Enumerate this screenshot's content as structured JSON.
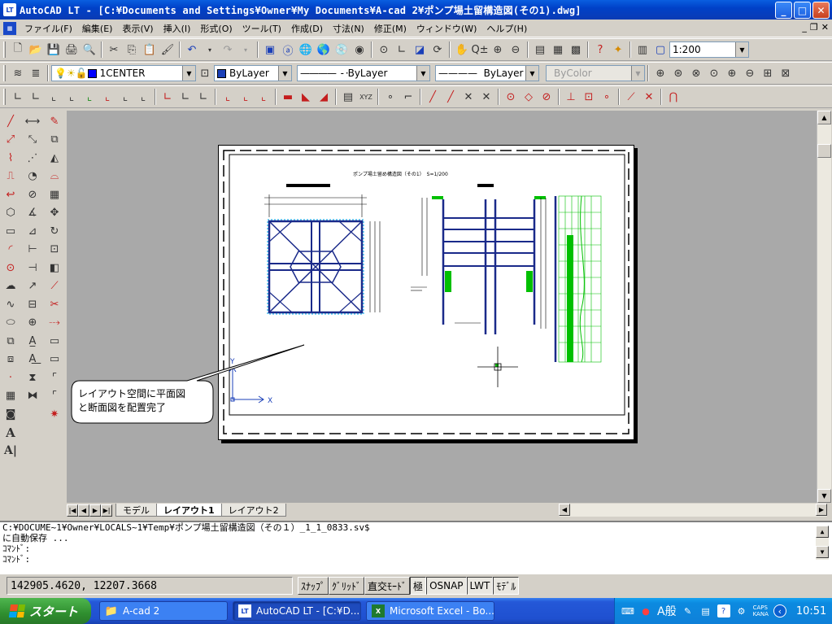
{
  "window": {
    "app_icon": "LT",
    "title": "AutoCAD LT - [C:¥Documents and Settings¥Owner¥My Documents¥A-cad 2¥ポンプ場土留構造図(その1).dwg]",
    "min": "_",
    "max": "□",
    "close": "✕"
  },
  "menu": {
    "items": [
      "ファイル(F)",
      "編集(E)",
      "表示(V)",
      "挿入(I)",
      "形式(O)",
      "ツール(T)",
      "作成(D)",
      "寸法(N)",
      "修正(M)",
      "ウィンドウ(W)",
      "ヘルプ(H)"
    ],
    "mdi_min": "_",
    "mdi_restore": "❐",
    "mdi_close": "✕"
  },
  "toolbar_standard": {
    "scale_value": "1:200"
  },
  "toolbar_layers": {
    "layer_name": "1CENTER",
    "color_value": "ByLayer",
    "linetype_value": "ByLayer",
    "lineweight_value": "ByLayer",
    "plotstyle_value": "ByColor",
    "layer_color": "#0000ff",
    "bylayer_color": "#1a3fb8"
  },
  "drawing": {
    "sheet_title": "ポンプ場土留め構造図（その1）　S=1/200",
    "callout_text_line1": "レイアウト空間に平面図",
    "callout_text_line2": "と断面図を配置完了",
    "ucs_x": "X",
    "ucs_y": "Y",
    "line_color": "#1a2a8a",
    "accent_color": "#00c000"
  },
  "tabs": {
    "items": [
      "モデル",
      "レイアウト1",
      "レイアウト2"
    ],
    "active": "レイアウト1"
  },
  "command": {
    "lines": [
      "C:¥DOCUME~1¥Owner¥LOCALS~1¥Temp¥ポンプ場土留構造図（その１）_1_1_0833.sv$",
      "に自動保存 ...",
      "ｺﾏﾝﾄﾞ:",
      "ｺﾏﾝﾄﾞ:"
    ]
  },
  "status": {
    "coords": "142905.4620, 12207.3668",
    "buttons": [
      "ｽﾅｯﾌﾟ",
      "ｸﾞﾘｯﾄﾞ",
      "直交ﾓｰﾄﾞ",
      "極",
      "OSNAP",
      "LWT",
      "ﾓﾃﾞﾙ"
    ],
    "active_buttons": [
      "極",
      "OSNAP",
      "LWT",
      "ﾓﾃﾞﾙ"
    ]
  },
  "taskbar": {
    "start_label": "スタート",
    "tasks": [
      {
        "label": "A-cad 2",
        "icon": "folder-icon"
      },
      {
        "label": "AutoCAD LT - [C:¥D...",
        "icon": "autocad-icon"
      },
      {
        "label": "Microsoft Excel - Bo...",
        "icon": "excel-icon"
      }
    ],
    "ime": "A般",
    "caps": "CAPS",
    "kana": "KANA",
    "clock": "10:51"
  }
}
